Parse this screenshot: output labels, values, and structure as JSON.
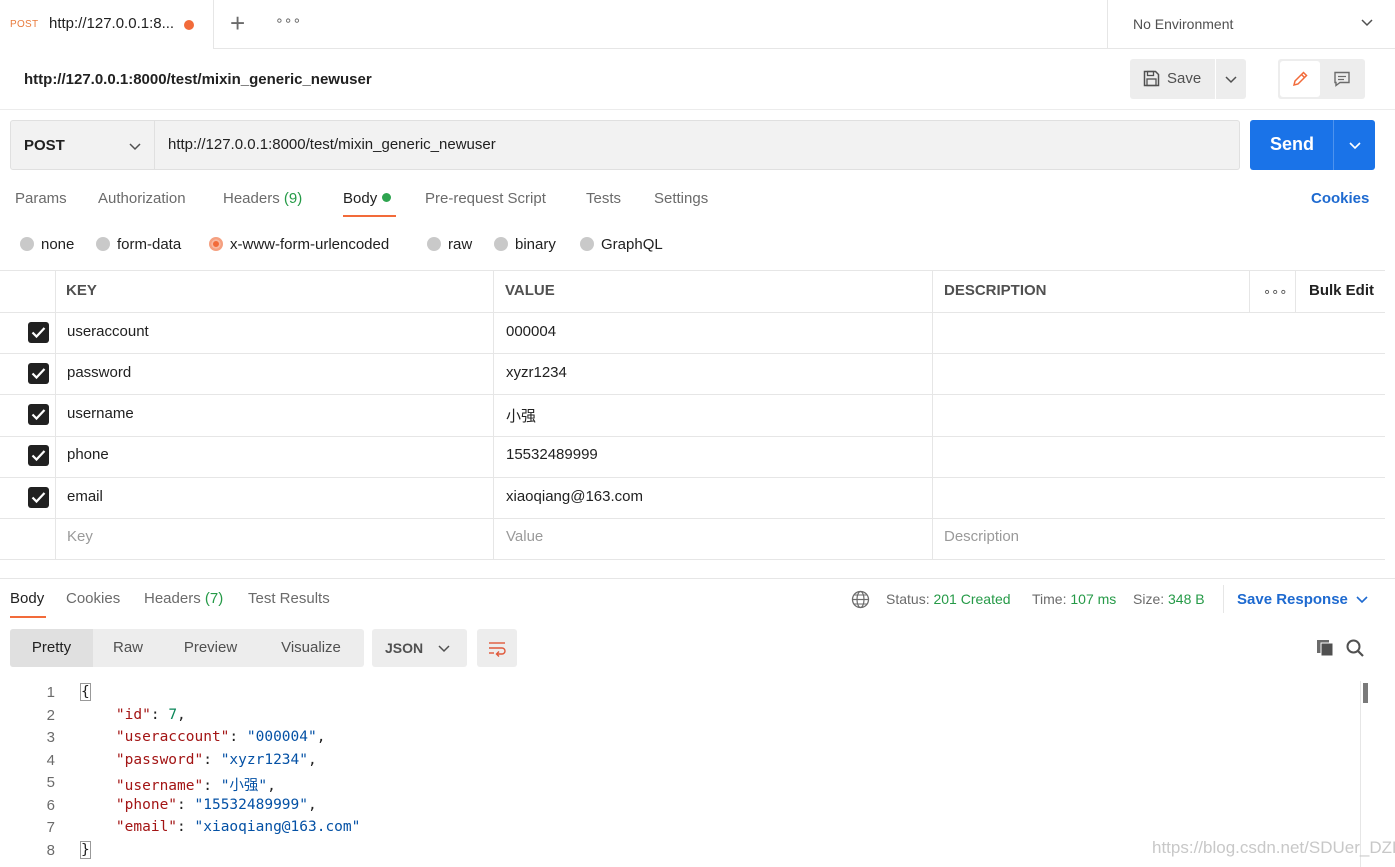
{
  "tabbar": {
    "tab_method": "POST",
    "tab_title": "http://127.0.0.1:8...",
    "new_tab": "+",
    "more": "∘∘∘",
    "environment": "No Environment"
  },
  "header": {
    "title": "http://127.0.0.1:8000/test/mixin_generic_newuser",
    "save_label": "Save"
  },
  "request": {
    "method": "POST",
    "url": "http://127.0.0.1:8000/test/mixin_generic_newuser",
    "send_label": "Send"
  },
  "request_tabs": {
    "params": "Params",
    "authorization": "Authorization",
    "headers": "Headers",
    "headers_count": "(9)",
    "body": "Body",
    "prerequest": "Pre-request Script",
    "tests": "Tests",
    "settings": "Settings",
    "cookies": "Cookies"
  },
  "body_types": {
    "none": "none",
    "form_data": "form-data",
    "urlencoded": "x-www-form-urlencoded",
    "raw": "raw",
    "binary": "binary",
    "graphql": "GraphQL",
    "selected": "x-www-form-urlencoded"
  },
  "params_table": {
    "headers": {
      "key": "KEY",
      "value": "VALUE",
      "description": "DESCRIPTION",
      "more": "∘∘∘",
      "bulk_edit": "Bulk Edit"
    },
    "rows": [
      {
        "checked": true,
        "key": "useraccount",
        "value": "000004",
        "description": ""
      },
      {
        "checked": true,
        "key": "password",
        "value": "xyzr1234",
        "description": ""
      },
      {
        "checked": true,
        "key": "username",
        "value": "小强",
        "description": ""
      },
      {
        "checked": true,
        "key": "phone",
        "value": "15532489999",
        "description": ""
      },
      {
        "checked": true,
        "key": "email",
        "value": "xiaoqiang@163.com",
        "description": ""
      }
    ],
    "placeholders": {
      "key": "Key",
      "value": "Value",
      "description": "Description"
    }
  },
  "response": {
    "tabs": {
      "body": "Body",
      "cookies": "Cookies",
      "headers": "Headers",
      "headers_count": "(7)",
      "test_results": "Test Results"
    },
    "status_label": "Status:",
    "status_value": "201 Created",
    "time_label": "Time:",
    "time_value": "107 ms",
    "size_label": "Size:",
    "size_value": "348 B",
    "save_response": "Save Response",
    "views": {
      "pretty": "Pretty",
      "raw": "Raw",
      "preview": "Preview",
      "visualize": "Visualize"
    },
    "format": "JSON",
    "code_lines": [
      "{",
      "    \"id\": 7,",
      "    \"useraccount\": \"000004\",",
      "    \"password\": \"xyzr1234\",",
      "    \"username\": \"小强\",",
      "    \"phone\": \"15532489999\",",
      "    \"email\": \"xiaoqiang@163.com\"",
      "}"
    ]
  },
  "watermark": "https://blog.csdn.net/SDUer_DZL",
  "colors": {
    "accent": "#f26b3a",
    "send": "#1a73e8",
    "link": "#1e6ad0",
    "success": "#259a47"
  },
  "icons": [
    "chevron-down-icon",
    "save-icon",
    "pencil-icon",
    "comment-icon",
    "globe-icon",
    "wrap-icon",
    "copy-icon",
    "search-icon",
    "check-icon"
  ]
}
